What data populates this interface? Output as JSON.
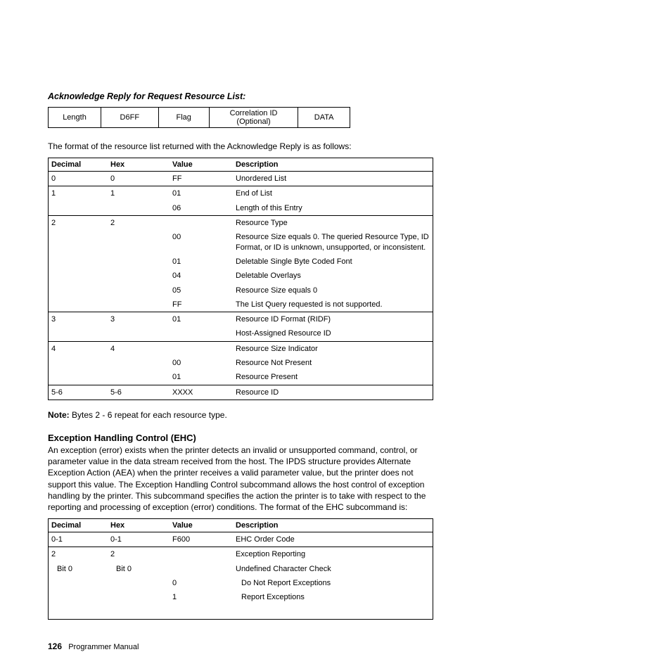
{
  "header_italic": "Acknowledge Reply for Request Resource List:",
  "top_row": {
    "c1": "Length",
    "c2": "D6FF",
    "c3": "Flag",
    "c4": "Correlation ID (Optional)",
    "c5": "DATA"
  },
  "intro_para": "The format of the resource list returned with the Acknowledge Reply is as follows:",
  "t1_headers": {
    "dec": "Decimal",
    "hex": "Hex",
    "val": "Value",
    "desc": "Description"
  },
  "t1_rows": [
    {
      "sep": true,
      "dec": "0",
      "hex": "0",
      "val": "FF",
      "desc": "Unordered List"
    },
    {
      "sep": true,
      "dec": "1",
      "hex": "1",
      "val": "01",
      "desc": "End of List"
    },
    {
      "sep": false,
      "dec": "",
      "hex": "",
      "val": "06",
      "desc": "Length of this Entry"
    },
    {
      "sep": true,
      "dec": "2",
      "hex": "2",
      "val": "",
      "desc": "Resource Type"
    },
    {
      "sep": false,
      "dec": "",
      "hex": "",
      "val": "00",
      "desc": "Resource Size equals 0. The queried Resource Type, ID Format, or ID is unknown, unsupported, or inconsistent."
    },
    {
      "sep": false,
      "dec": "",
      "hex": "",
      "val": "01",
      "desc": "Deletable Single Byte Coded Font"
    },
    {
      "sep": false,
      "dec": "",
      "hex": "",
      "val": "04",
      "desc": "Deletable Overlays"
    },
    {
      "sep": false,
      "dec": "",
      "hex": "",
      "val": "05",
      "desc": "Resource Size equals 0"
    },
    {
      "sep": false,
      "dec": "",
      "hex": "",
      "val": "FF",
      "desc": "The List Query requested is not supported."
    },
    {
      "sep": true,
      "dec": "3",
      "hex": "3",
      "val": "01",
      "desc": "Resource ID Format (RIDF)"
    },
    {
      "sep": false,
      "dec": "",
      "hex": "",
      "val": "",
      "desc": "Host-Assigned Resource ID"
    },
    {
      "sep": true,
      "dec": "4",
      "hex": "4",
      "val": "",
      "desc": "Resource Size Indicator"
    },
    {
      "sep": false,
      "dec": "",
      "hex": "",
      "val": "00",
      "desc": "Resource Not Present"
    },
    {
      "sep": false,
      "dec": "",
      "hex": "",
      "val": "01",
      "desc": "Resource Present"
    },
    {
      "sep": true,
      "dec": "5-6",
      "hex": "5-6",
      "val": "XXXX",
      "desc": "Resource ID"
    }
  ],
  "note_label": "Note:",
  "note_text": "  Bytes 2 - 6 repeat for each resource type.",
  "ehc_title": "Exception Handling Control (EHC)",
  "ehc_para": "An exception (error) exists when the printer detects an invalid or unsupported command, control, or parameter value in the data stream received from the host. The IPDS structure provides Alternate Exception Action (AEA) when the printer receives a valid parameter value, but the printer does not support this value. The Exception Handling Control subcommand allows the host control of exception handling by the printer. This subcommand specifies the action the printer is to take with respect to the reporting and processing of exception (error) conditions. The format of the EHC subcommand is:",
  "t2_headers": {
    "dec": "Decimal",
    "hex": "Hex",
    "val": "Value",
    "desc": "Description"
  },
  "t2": {
    "r1": {
      "dec": "0-1",
      "hex": "0-1",
      "val": "F600",
      "desc": "EHC Order Code"
    },
    "r2": {
      "dec": "2",
      "hex": "2",
      "val": "",
      "desc": "Exception Reporting"
    },
    "bit": {
      "dec": "Bit 0",
      "hex": "Bit 0",
      "desc": "Undefined Character Check"
    },
    "opt0": {
      "val": "0",
      "desc": "Do Not Report Exceptions"
    },
    "opt1": {
      "val": "1",
      "desc": "Report Exceptions"
    }
  },
  "footer": {
    "page": "126",
    "title": "Programmer Manual"
  }
}
